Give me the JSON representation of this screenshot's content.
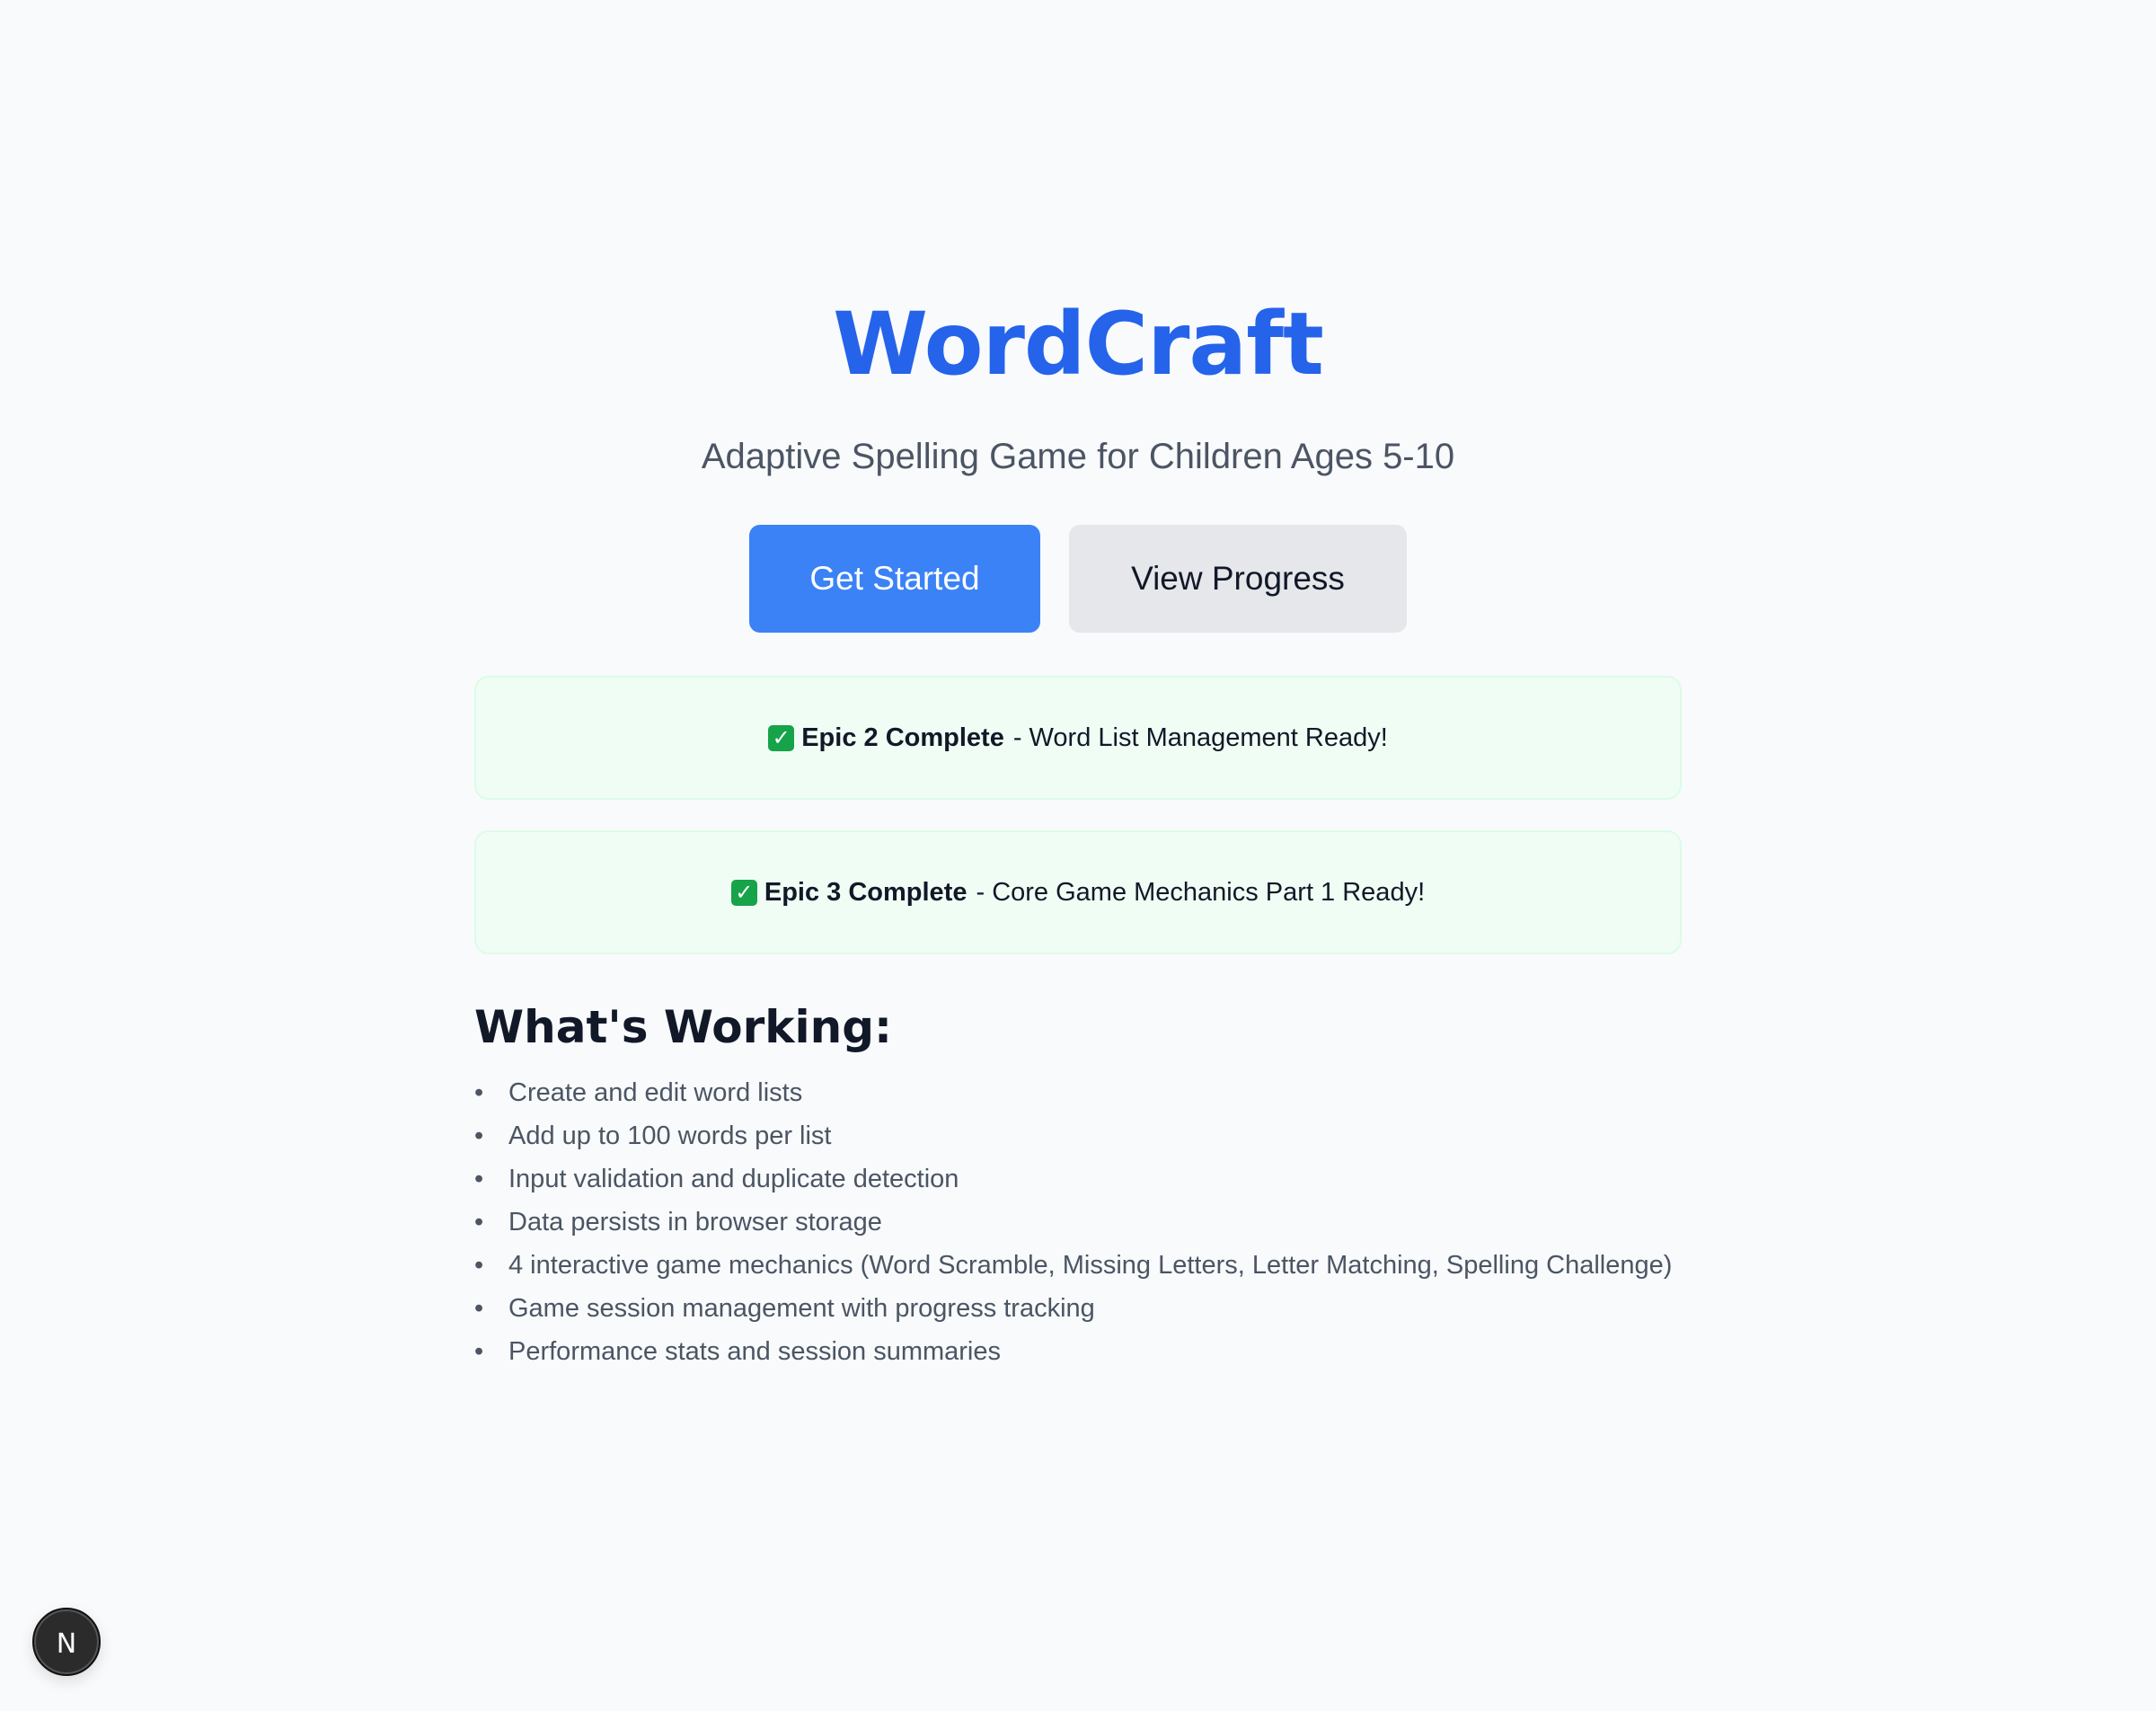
{
  "header": {
    "title": "WordCraft",
    "subtitle": "Adaptive Spelling Game for Children Ages 5-10"
  },
  "actions": {
    "primary_label": "Get Started",
    "secondary_label": "View Progress"
  },
  "banners": [
    {
      "icon": "check-mark-icon",
      "icon_glyph": "✓",
      "bold": "Epic 2 Complete",
      "text": "- Word List Management Ready!"
    },
    {
      "icon": "check-mark-icon",
      "icon_glyph": "✓",
      "bold": "Epic 3 Complete",
      "text": "- Core Game Mechanics Part 1 Ready!"
    }
  ],
  "features": {
    "heading": "What's Working:",
    "bullet": "•",
    "items": [
      "Create and edit word lists",
      "Add up to 100 words per list",
      "Input validation and duplicate detection",
      "Data persists in browser storage",
      "4 interactive game mechanics (Word Scramble, Missing Letters, Letter Matching, Spelling Challenge)",
      "Game session management with progress tracking",
      "Performance stats and session summaries"
    ]
  },
  "dev_badge": {
    "icon": "nextjs-icon",
    "letter": "N"
  },
  "colors": {
    "background": "#f8fafc",
    "accent": "#2563eb",
    "primary_button": "#3b82f6",
    "secondary_button": "#e5e7eb",
    "banner_background": "#f0fdf4",
    "banner_border": "#dcfce7",
    "check_icon": "#16a34a"
  }
}
